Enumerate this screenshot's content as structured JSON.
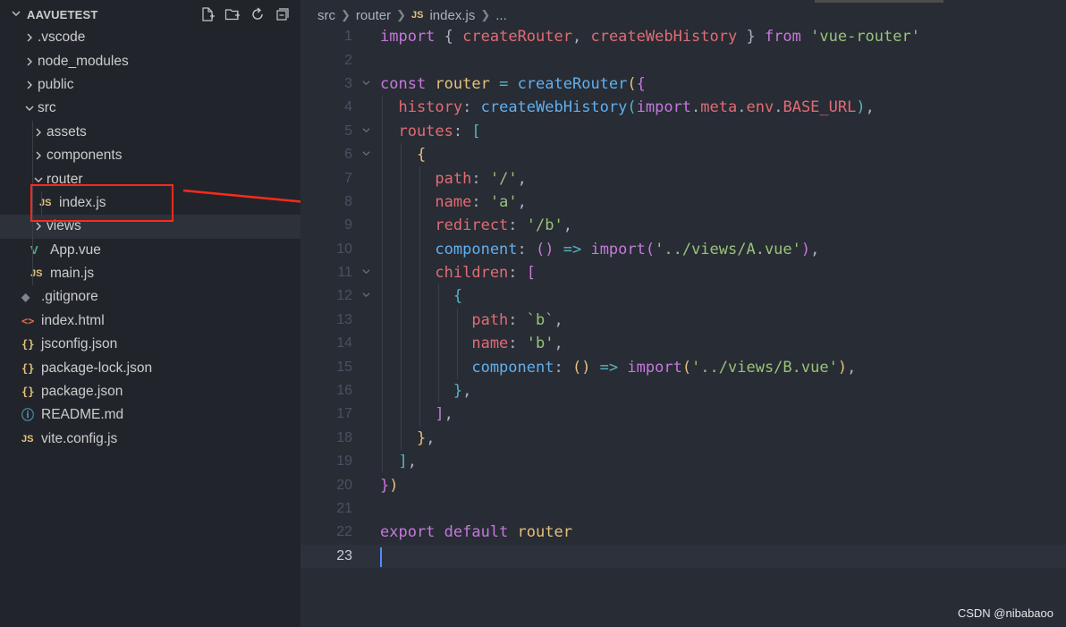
{
  "explorer": {
    "title": "AAVUETEST",
    "actions": [
      {
        "icon": "new-file-icon"
      },
      {
        "icon": "new-folder-icon"
      },
      {
        "icon": "refresh-icon"
      },
      {
        "icon": "collapse-all-icon"
      }
    ],
    "items": [
      {
        "label": ".vscode",
        "depth": 0,
        "kind": "folder",
        "open": false
      },
      {
        "label": "node_modules",
        "depth": 0,
        "kind": "folder",
        "open": false
      },
      {
        "label": "public",
        "depth": 0,
        "kind": "folder",
        "open": false
      },
      {
        "label": "src",
        "depth": 0,
        "kind": "folder",
        "open": true
      },
      {
        "label": "assets",
        "depth": 1,
        "kind": "folder",
        "open": false
      },
      {
        "label": "components",
        "depth": 1,
        "kind": "folder",
        "open": false
      },
      {
        "label": "router",
        "depth": 1,
        "kind": "folder",
        "open": true
      },
      {
        "label": "index.js",
        "depth": 2,
        "kind": "file",
        "icon": "js-icon",
        "icon_text": "JS"
      },
      {
        "label": "views",
        "depth": 1,
        "kind": "folder",
        "open": false,
        "selected": true
      },
      {
        "label": "App.vue",
        "depth": 1,
        "kind": "file",
        "icon": "vue-icon",
        "icon_text": "V"
      },
      {
        "label": "main.js",
        "depth": 1,
        "kind": "file",
        "icon": "js-icon",
        "icon_text": "JS"
      },
      {
        "label": ".gitignore",
        "depth": 0,
        "kind": "file",
        "icon": "git-icon",
        "icon_text": "◆"
      },
      {
        "label": "index.html",
        "depth": 0,
        "kind": "file",
        "icon": "html-icon",
        "icon_text": "<>"
      },
      {
        "label": "jsconfig.json",
        "depth": 0,
        "kind": "file",
        "icon": "json-icon",
        "icon_text": "{}"
      },
      {
        "label": "package-lock.json",
        "depth": 0,
        "kind": "file",
        "icon": "json-icon",
        "icon_text": "{}"
      },
      {
        "label": "package.json",
        "depth": 0,
        "kind": "file",
        "icon": "json-icon",
        "icon_text": "{}"
      },
      {
        "label": "README.md",
        "depth": 0,
        "kind": "file",
        "icon": "info-icon",
        "icon_text": "ⓘ"
      },
      {
        "label": "vite.config.js",
        "depth": 0,
        "kind": "file",
        "icon": "js-icon",
        "icon_text": "JS"
      }
    ]
  },
  "breadcrumb": {
    "parts": [
      "src",
      "router"
    ],
    "file_icon_text": "JS",
    "file": "index.js",
    "tail": "..."
  },
  "editor": {
    "current_line": 23,
    "lines": [
      {
        "n": 1,
        "fold": false,
        "guides": 0,
        "tokens": [
          [
            "import",
            "keyword"
          ],
          [
            " ",
            "punc"
          ],
          [
            "{",
            "punc"
          ],
          [
            " createRouter",
            "var"
          ],
          [
            ",",
            "punc"
          ],
          [
            " createWebHistory",
            "var"
          ],
          [
            " }",
            "punc"
          ],
          [
            " from",
            "keyword"
          ],
          [
            " 'vue-router'",
            "string"
          ]
        ]
      },
      {
        "n": 2,
        "fold": false,
        "guides": 0,
        "tokens": []
      },
      {
        "n": 3,
        "fold": true,
        "guides": 0,
        "tokens": [
          [
            "const",
            "keyword"
          ],
          [
            " router",
            "type"
          ],
          [
            " =",
            "op"
          ],
          [
            " createRouter",
            "func"
          ],
          [
            "(",
            "brace"
          ],
          [
            "{",
            "brace2"
          ]
        ]
      },
      {
        "n": 4,
        "fold": false,
        "guides": 1,
        "tokens": [
          [
            "  history",
            "prop"
          ],
          [
            ":",
            "punc"
          ],
          [
            " createWebHistory",
            "func"
          ],
          [
            "(",
            "brace3"
          ],
          [
            "import",
            "keyword"
          ],
          [
            ".",
            "punc"
          ],
          [
            "meta",
            "var"
          ],
          [
            ".",
            "punc"
          ],
          [
            "env",
            "var"
          ],
          [
            ".",
            "punc"
          ],
          [
            "BASE_URL",
            "var"
          ],
          [
            ")",
            "brace3"
          ],
          [
            ",",
            "punc"
          ]
        ]
      },
      {
        "n": 5,
        "fold": true,
        "guides": 1,
        "tokens": [
          [
            "  routes",
            "prop"
          ],
          [
            ":",
            "punc"
          ],
          [
            " [",
            "brace3"
          ]
        ]
      },
      {
        "n": 6,
        "fold": true,
        "guides": 2,
        "tokens": [
          [
            "    {",
            "brace"
          ]
        ]
      },
      {
        "n": 7,
        "fold": false,
        "guides": 3,
        "tokens": [
          [
            "      path",
            "prop"
          ],
          [
            ":",
            "punc"
          ],
          [
            " '/'",
            "string"
          ],
          [
            ",",
            "punc"
          ]
        ]
      },
      {
        "n": 8,
        "fold": false,
        "guides": 3,
        "tokens": [
          [
            "      name",
            "prop"
          ],
          [
            ":",
            "punc"
          ],
          [
            " 'a'",
            "string"
          ],
          [
            ",",
            "punc"
          ]
        ]
      },
      {
        "n": 9,
        "fold": false,
        "guides": 3,
        "tokens": [
          [
            "      redirect",
            "prop"
          ],
          [
            ":",
            "punc"
          ],
          [
            " '/b'",
            "string"
          ],
          [
            ",",
            "punc"
          ]
        ]
      },
      {
        "n": 10,
        "fold": false,
        "guides": 3,
        "tokens": [
          [
            "      component",
            "func"
          ],
          [
            ":",
            "punc"
          ],
          [
            " ()",
            "brace2"
          ],
          [
            " =>",
            "op"
          ],
          [
            " import",
            "keyword"
          ],
          [
            "(",
            "brace2"
          ],
          [
            "'../views/A.vue'",
            "string"
          ],
          [
            ")",
            "brace2"
          ],
          [
            ",",
            "punc"
          ]
        ]
      },
      {
        "n": 11,
        "fold": true,
        "guides": 3,
        "tokens": [
          [
            "      children",
            "prop"
          ],
          [
            ":",
            "punc"
          ],
          [
            " [",
            "brace2"
          ]
        ]
      },
      {
        "n": 12,
        "fold": true,
        "guides": 4,
        "tokens": [
          [
            "        {",
            "brace3"
          ]
        ]
      },
      {
        "n": 13,
        "fold": false,
        "guides": 5,
        "tokens": [
          [
            "          path",
            "prop"
          ],
          [
            ":",
            "punc"
          ],
          [
            " `b`",
            "string"
          ],
          [
            ",",
            "punc"
          ]
        ]
      },
      {
        "n": 14,
        "fold": false,
        "guides": 5,
        "tokens": [
          [
            "          name",
            "prop"
          ],
          [
            ":",
            "punc"
          ],
          [
            " 'b'",
            "string"
          ],
          [
            ",",
            "punc"
          ]
        ]
      },
      {
        "n": 15,
        "fold": false,
        "guides": 5,
        "tokens": [
          [
            "          component",
            "func"
          ],
          [
            ":",
            "punc"
          ],
          [
            " ()",
            "brace"
          ],
          [
            " =>",
            "op"
          ],
          [
            " import",
            "keyword"
          ],
          [
            "(",
            "brace"
          ],
          [
            "'../views/B.vue'",
            "string"
          ],
          [
            ")",
            "brace"
          ],
          [
            ",",
            "punc"
          ]
        ]
      },
      {
        "n": 16,
        "fold": false,
        "guides": 4,
        "tokens": [
          [
            "        }",
            "brace3"
          ],
          [
            ",",
            "punc"
          ]
        ]
      },
      {
        "n": 17,
        "fold": false,
        "guides": 3,
        "tokens": [
          [
            "      ]",
            "brace2"
          ],
          [
            ",",
            "punc"
          ]
        ]
      },
      {
        "n": 18,
        "fold": false,
        "guides": 2,
        "tokens": [
          [
            "    }",
            "brace"
          ],
          [
            ",",
            "punc"
          ]
        ]
      },
      {
        "n": 19,
        "fold": false,
        "guides": 1,
        "tokens": [
          [
            "  ]",
            "brace3"
          ],
          [
            ",",
            "punc"
          ]
        ]
      },
      {
        "n": 20,
        "fold": false,
        "guides": 0,
        "tokens": [
          [
            "}",
            "brace2"
          ],
          [
            ")",
            "brace"
          ]
        ]
      },
      {
        "n": 21,
        "fold": false,
        "guides": 0,
        "tokens": []
      },
      {
        "n": 22,
        "fold": false,
        "guides": 0,
        "tokens": [
          [
            "export",
            "keyword"
          ],
          [
            " default",
            "keyword"
          ],
          [
            " router",
            "type"
          ]
        ]
      },
      {
        "n": 23,
        "fold": false,
        "guides": 0,
        "tokens": []
      }
    ]
  },
  "watermark": "CSDN @nibabaoo"
}
